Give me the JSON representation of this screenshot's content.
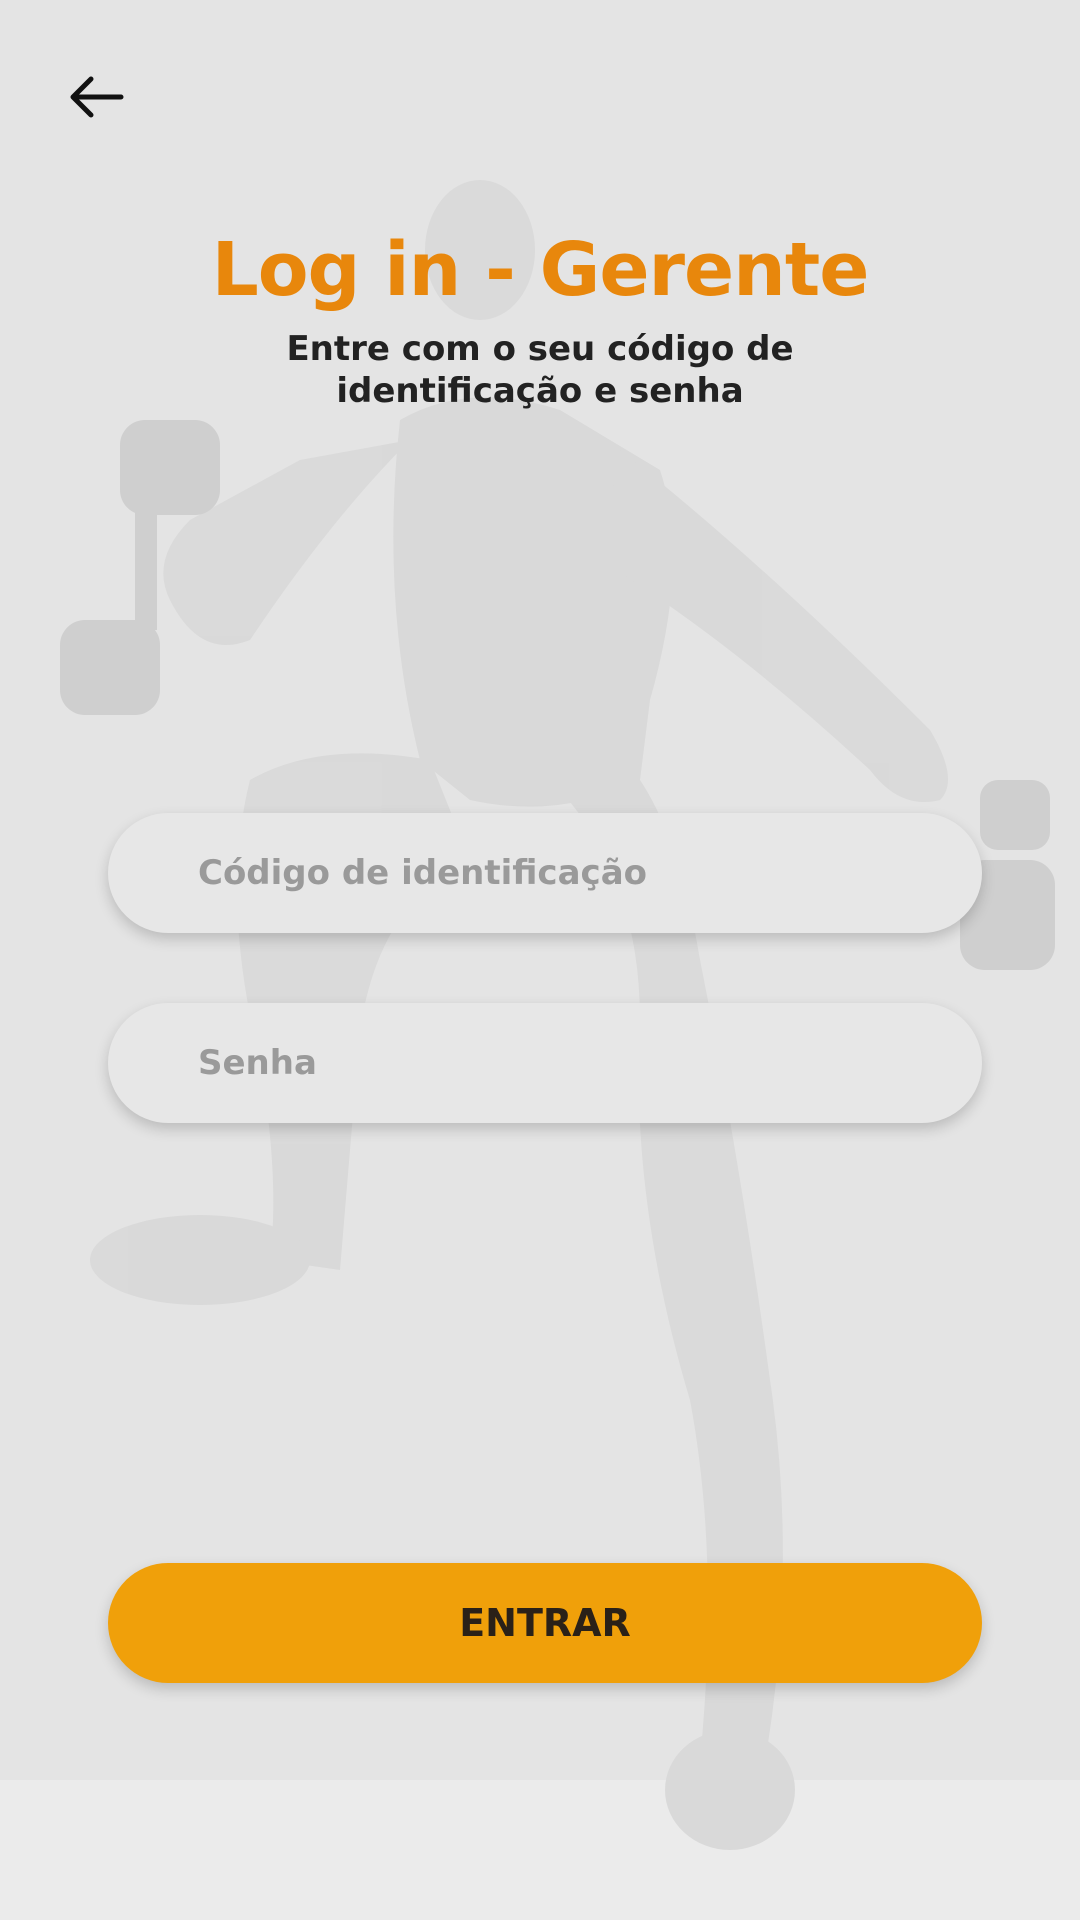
{
  "header": {
    "back_icon": "arrow-left-icon",
    "title": "Log in - Gerente",
    "subtitle": "Entre com o seu código de identificação e senha"
  },
  "form": {
    "code_placeholder": "Código de identificação",
    "code_value": "",
    "password_placeholder": "Senha",
    "password_value": ""
  },
  "actions": {
    "submit_label": "ENTRAR"
  },
  "colors": {
    "title": "#e8870c",
    "button": "#f0a00a",
    "background": "#e4e4e4"
  }
}
